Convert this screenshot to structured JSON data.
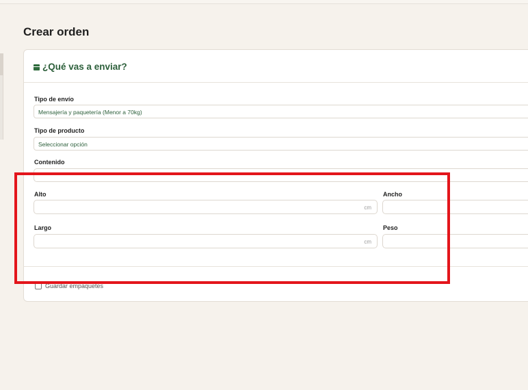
{
  "page": {
    "title": "Crear orden"
  },
  "card": {
    "title": "¿Qué vas a enviar?",
    "icon": "package-icon",
    "shipment_type": {
      "label": "Tipo de envío",
      "value": "Mensajería y paquetería (Menor a 70kg)"
    },
    "product_type": {
      "label": "Tipo de producto",
      "value": "Seleccionar opción"
    },
    "content": {
      "label": "Contenido",
      "value": ""
    },
    "height": {
      "label": "Alto",
      "value": "",
      "unit": "cm"
    },
    "width": {
      "label": "Ancho",
      "value": ""
    },
    "length": {
      "label": "Largo",
      "value": "",
      "unit": "cm"
    },
    "weight": {
      "label": "Peso",
      "value": ""
    },
    "save_package": {
      "label": "Guardar empaquetes",
      "checked": false
    }
  },
  "annotation": {
    "color": "#e3151b"
  }
}
